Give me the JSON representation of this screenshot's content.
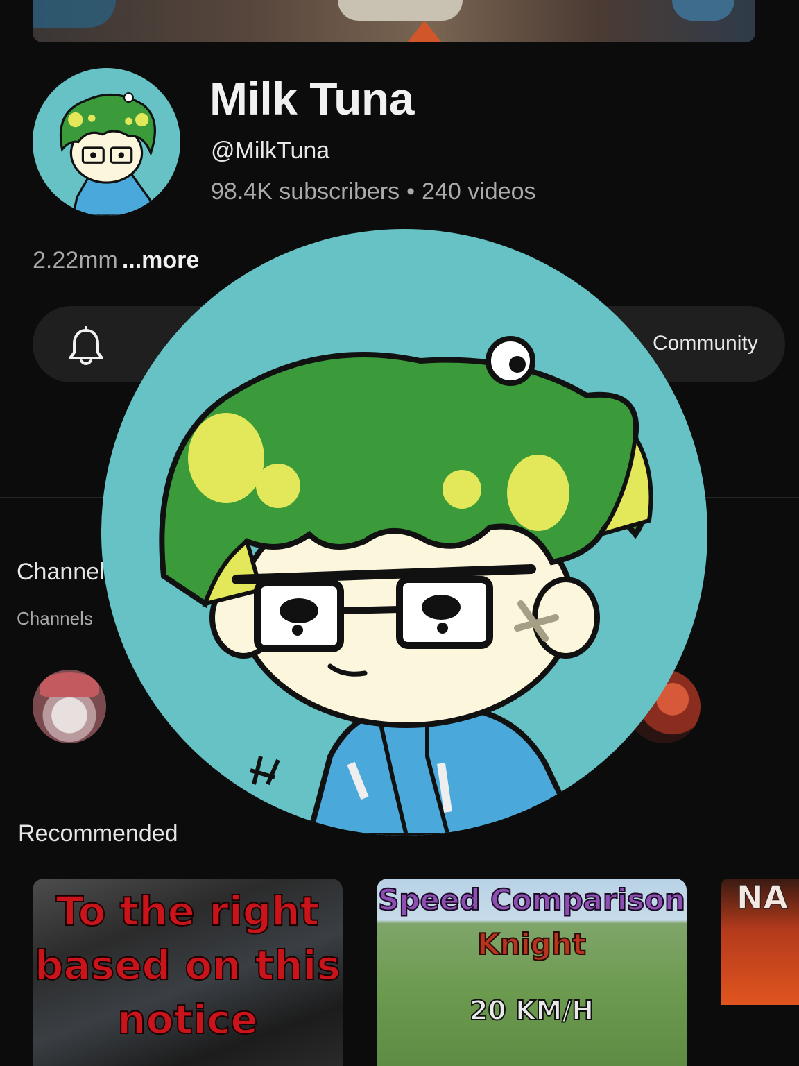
{
  "channel": {
    "name": "Milk Tuna",
    "handle": "@MilkTuna",
    "subscribers": "98.4K subscribers",
    "separator": "•",
    "videos": "240 videos",
    "description": "2.22mm",
    "more_label": "...more"
  },
  "actions": {
    "bell_icon": "bell-icon",
    "community_label": "Community"
  },
  "channels_section": {
    "title": "Channels",
    "subtitle": "Channels"
  },
  "recommended": {
    "title": "Recommended",
    "thumbnails": [
      {
        "text": "To the right based on this notice"
      },
      {
        "line1": "Speed Comparison",
        "line2": "Knight",
        "line3": "20 KM/H"
      },
      {
        "text": "NA"
      }
    ]
  },
  "colors": {
    "background": "#0c0c0c",
    "pill": "#1f1f1f",
    "avatar_bg": "#66c2c5",
    "hair_green": "#3b9b3a",
    "hair_yellow": "#e3e75a",
    "hoodie_blue": "#4aa8db"
  }
}
